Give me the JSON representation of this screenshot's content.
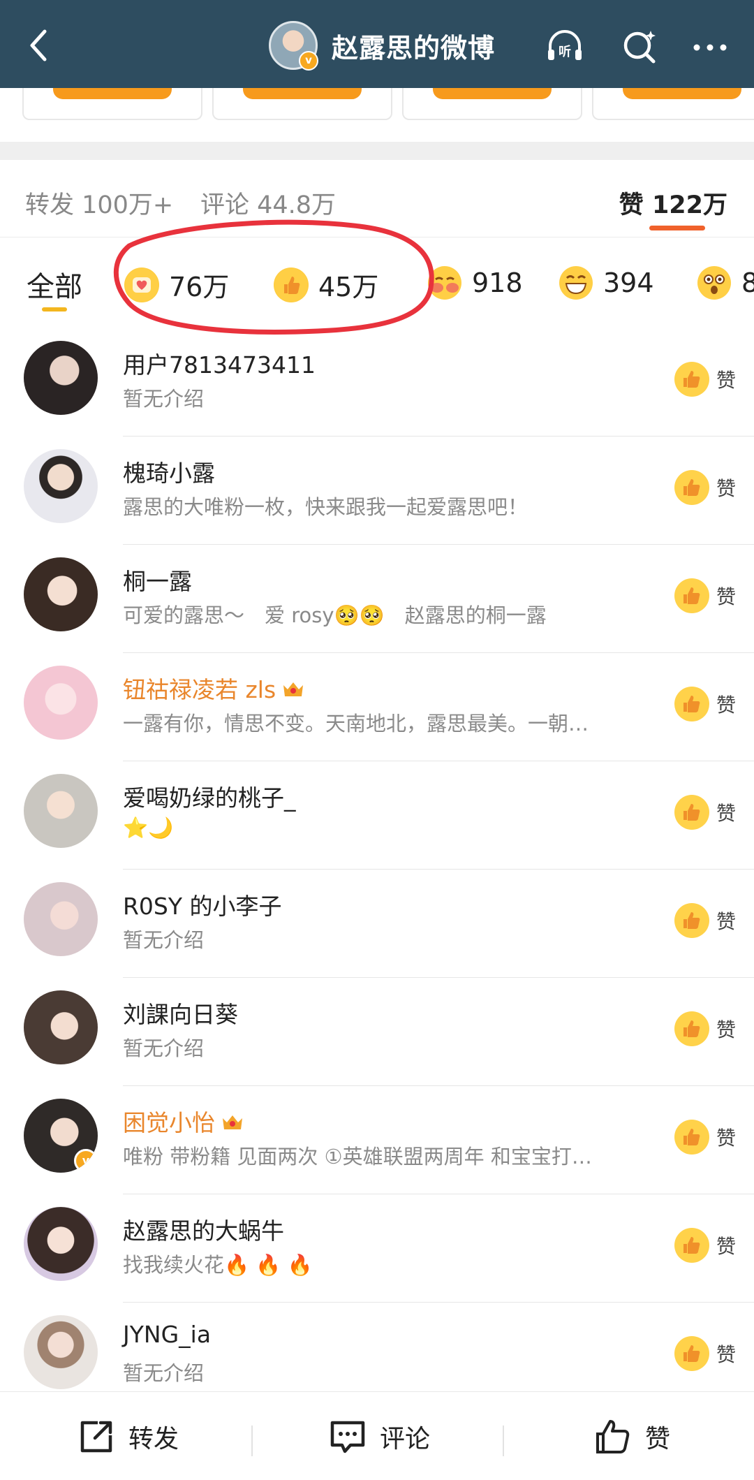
{
  "header": {
    "title": "赵露思的微博",
    "avatar_badge": "v",
    "bg_color": "#2e4d60"
  },
  "stats": {
    "repost": "转发 100万+",
    "comment": "评论 44.8万",
    "like_label": "赞",
    "like_count": "122万"
  },
  "reaction_tabs": {
    "all_label": "全部",
    "items": [
      {
        "icon": "heart-face-icon",
        "count": "76万"
      },
      {
        "icon": "thumbs-up-icon",
        "count": "45万"
      },
      {
        "icon": "hug-face-icon",
        "count": "918"
      },
      {
        "icon": "grin-face-icon",
        "count": "394"
      },
      {
        "icon": "surprised-face-icon",
        "count": "8"
      }
    ]
  },
  "users": [
    {
      "name": "用户7813473411",
      "desc": "暂无介绍",
      "gold": false,
      "crown": false,
      "verified": false
    },
    {
      "name": "槐琦小露",
      "desc": "露思的大唯粉一枚，快来跟我一起爱露思吧！",
      "gold": false,
      "crown": false,
      "verified": false
    },
    {
      "name": "桐一露",
      "desc": "可爱的露思～　爱 rosy🥺🥺　赵露思的桐一露",
      "gold": false,
      "crown": false,
      "verified": false
    },
    {
      "name": "钮祜禄凌若 zls",
      "desc": "一露有你，情思不变。天南地北，露思最美。一朝…",
      "gold": true,
      "crown": true,
      "verified": false
    },
    {
      "name": "爱喝奶绿的桃子_",
      "desc": "⭐🌙",
      "gold": false,
      "crown": false,
      "verified": false
    },
    {
      "name": "R0SY 的小李子",
      "desc": "暂无介绍",
      "gold": false,
      "crown": false,
      "verified": false
    },
    {
      "name": "刘課向日葵",
      "desc": "暂无介绍",
      "gold": false,
      "crown": false,
      "verified": false
    },
    {
      "name": "困觉小怡",
      "desc": "唯粉 带粉籍 见面两次 ①英雄联盟两周年 和宝宝打…",
      "gold": true,
      "crown": true,
      "verified": true
    },
    {
      "name": "赵露思的大蜗牛",
      "desc": "找我续火花🔥 🔥 🔥",
      "gold": false,
      "crown": false,
      "verified": false
    },
    {
      "name": "JYNG_ia",
      "desc": "暂无介绍",
      "gold": false,
      "crown": false,
      "verified": false
    }
  ],
  "like_btn_label": "赞",
  "bottom_bar": {
    "repost": "转发",
    "comment": "评论",
    "like": "赞"
  },
  "colors": {
    "accent_orange": "#f0612b",
    "gold_name": "#e9862c",
    "annotation_red": "#e8323c"
  }
}
